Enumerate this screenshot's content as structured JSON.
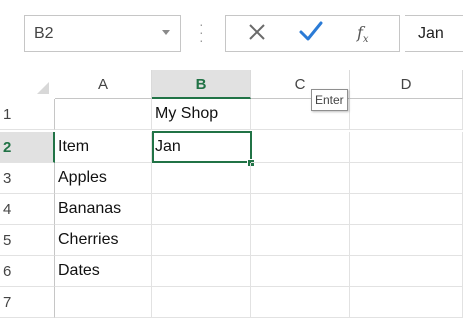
{
  "formula_bar": {
    "name_box": "B2",
    "content": "Jan"
  },
  "tooltip": "Enter",
  "icons": {
    "cancel": "cancel-x-icon",
    "enter": "enter-check-icon",
    "insert_function": "fx-icon"
  },
  "colors": {
    "accent": "#217346",
    "header_active_bg": "#e1e1e1",
    "enter_check": "#2b7bd6"
  },
  "grid": {
    "columns": [
      "A",
      "B",
      "C",
      "D"
    ],
    "active_column": "B",
    "rows": [
      {
        "num": "1",
        "cells": [
          "",
          "My Shop",
          "",
          ""
        ]
      },
      {
        "num": "2",
        "cells": [
          "Item",
          "Jan",
          "",
          ""
        ]
      },
      {
        "num": "3",
        "cells": [
          "Apples",
          "",
          "",
          ""
        ]
      },
      {
        "num": "4",
        "cells": [
          "Bananas",
          "",
          "",
          ""
        ]
      },
      {
        "num": "5",
        "cells": [
          "Cherries",
          "",
          "",
          ""
        ]
      },
      {
        "num": "6",
        "cells": [
          "Dates",
          "",
          "",
          ""
        ]
      },
      {
        "num": "7",
        "cells": [
          "",
          "",
          "",
          ""
        ]
      }
    ],
    "active_row": "2",
    "selected_cell": "B2"
  }
}
